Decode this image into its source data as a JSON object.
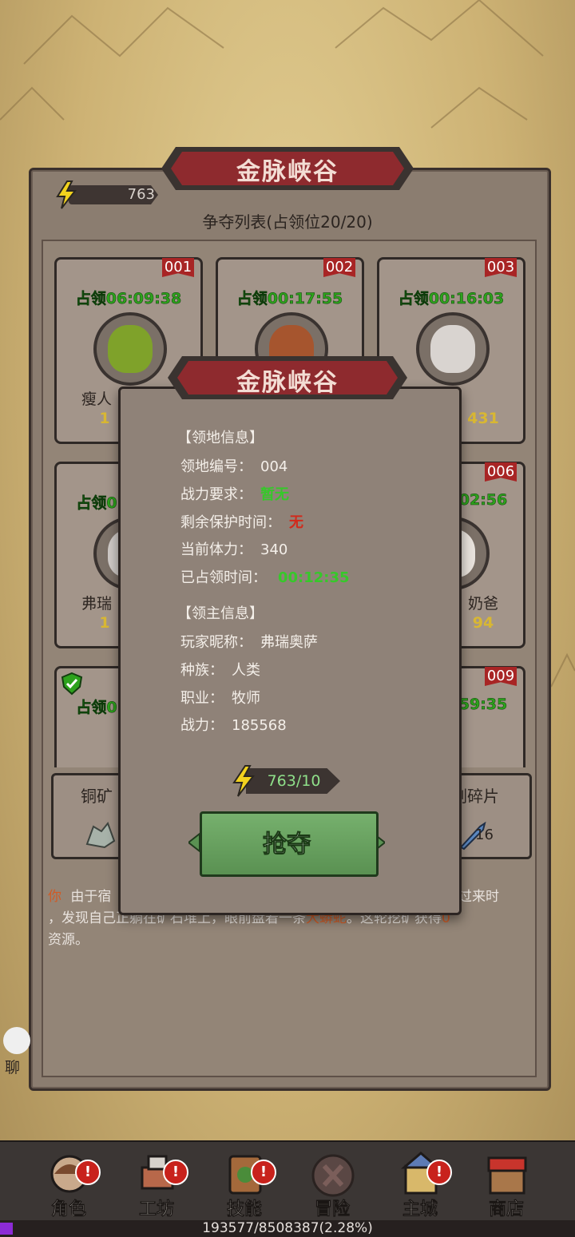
{
  "header": {
    "title": "金脉峡谷",
    "energy": "763",
    "list_title": "争夺列表(占领位20/20)"
  },
  "cards": [
    {
      "num": "001",
      "occupied": "占领06:09:38",
      "name": "瘦人",
      "power": "1"
    },
    {
      "num": "002",
      "occupied": "占领00:17:55",
      "name": "",
      "power": ""
    },
    {
      "num": "003",
      "occupied": "占领00:16:03",
      "name": "",
      "power": "431"
    },
    {
      "num": "",
      "occupied": "占领0",
      "name": "弗瑞",
      "power": "1"
    },
    {
      "num": "006",
      "occupied": "02:56",
      "name": "奶爸",
      "power": "94"
    },
    {
      "num": "",
      "occupied": "占领0",
      "name": "",
      "power": ""
    },
    {
      "num": "009",
      "occupied": "59:35",
      "name": "",
      "power": ""
    }
  ],
  "resources": [
    {
      "title": "铜矿",
      "qty": ""
    },
    {
      "title": "风之剑碎片",
      "qty": "16"
    }
  ],
  "log": {
    "you": "你",
    "text1": "由于宿",
    "text1b": "过来时",
    "text2": "，发现自己正躺在矿石堆上，眼前盘着一条",
    "snake": "大蟒蛇",
    "text3": "。这轮挖矿获得",
    "zero": "0",
    "text4": "资源。"
  },
  "modal": {
    "title": "金脉峡谷",
    "territory_header": "【领地信息】",
    "id_label": "领地编号：",
    "id_value": "004",
    "req_label": "战力要求：",
    "req_value": "暂无",
    "protect_label": "剩余保护时间：",
    "protect_value": "无",
    "stamina_label": "当前体力：",
    "stamina_value": "340",
    "occupied_label": "已占领时间：",
    "occupied_value": "00:12:35",
    "lord_header": "【领主信息】",
    "nick_label": "玩家昵称：",
    "nick_value": "弗瑞奥萨",
    "race_label": "种族：",
    "race_value": "人类",
    "class_label": "职业：",
    "class_value": "牧师",
    "power_label": "战力：",
    "power_value": "185568",
    "cost": "763/10",
    "grab_label": "抢夺"
  },
  "chat": {
    "label": "聊"
  },
  "nav": [
    {
      "label": "角色",
      "badge": "!",
      "icon": "character-icon"
    },
    {
      "label": "工坊",
      "badge": "!",
      "icon": "workshop-icon"
    },
    {
      "label": "技能",
      "badge": "!",
      "icon": "skill-book-icon"
    },
    {
      "label": "冒险",
      "badge": "",
      "icon": "adventure-icon"
    },
    {
      "label": "主城",
      "badge": "!",
      "icon": "castle-icon"
    },
    {
      "label": "商店",
      "badge": "",
      "icon": "shop-icon"
    }
  ],
  "exp": {
    "text": "193577/8508387(2.28%)",
    "progress": 0.0228
  },
  "colors": {
    "accent_red": "#a82525",
    "occupied_green": "#2da21c",
    "button_green": "#5a9152",
    "panel": "#8f8278"
  }
}
